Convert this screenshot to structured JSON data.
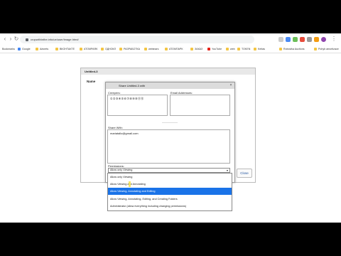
{
  "browser": {
    "url": "cropwithinthe.info/ue/user/image.htm#",
    "bookmarks": [
      "Bookmarks",
      "Google",
      "Adverts",
      "ВКОНТАКТЕ",
      "ATOMPARK",
      "ОДНОКЛ",
      "РАЗРАБОТКА",
      "webinars",
      "АТОМПАРК",
      "ЗАКАЗ",
      "YouTube",
      "web",
      "TOKEN",
      "Keitas",
      "Robovika Auctions",
      "Pohyb amortizace"
    ]
  },
  "page": {
    "dialog_title": "Untitled-3",
    "name_header": "Name",
    "close_button": "Close"
  },
  "share_dialog": {
    "title": "Share Untitled-3 with",
    "creepers_label": "Creepers:",
    "creepers_value": "①②③④⑤⑥⑦⑧⑨⑩⑪⑫",
    "email_label": "Email Addresses:",
    "share_with_label": "Share With:",
    "share_with_value": "mariatallo@gmail.com",
    "permissions_label": "Permissions:",
    "permissions_selected": "Allow only Viewing"
  },
  "permission_options": [
    "Allow only Viewing",
    "Allow Viewing and Annotating",
    "Allow Viewing, Annotating and Editing",
    "Allow Viewing, Annotating, Editing, and Creating Folders",
    "Administrator (allow everything including changing permissions)"
  ],
  "selected_option_index": 2,
  "colors": {
    "selection": "#1a73e8",
    "title_bar": "#dcdcdc"
  }
}
